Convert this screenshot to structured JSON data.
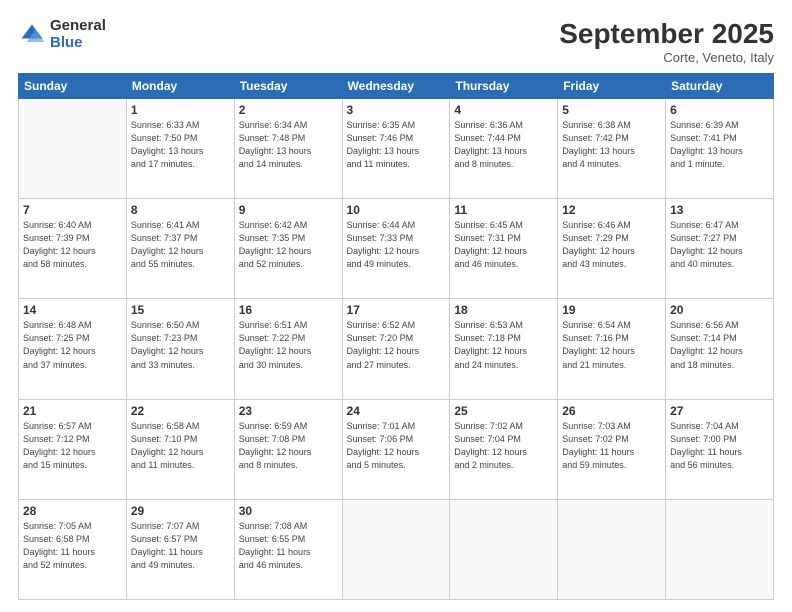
{
  "logo": {
    "general": "General",
    "blue": "Blue"
  },
  "header": {
    "title": "September 2025",
    "location": "Corte, Veneto, Italy"
  },
  "weekdays": [
    "Sunday",
    "Monday",
    "Tuesday",
    "Wednesday",
    "Thursday",
    "Friday",
    "Saturday"
  ],
  "weeks": [
    [
      {
        "day": "",
        "info": ""
      },
      {
        "day": "1",
        "info": "Sunrise: 6:33 AM\nSunset: 7:50 PM\nDaylight: 13 hours\nand 17 minutes."
      },
      {
        "day": "2",
        "info": "Sunrise: 6:34 AM\nSunset: 7:48 PM\nDaylight: 13 hours\nand 14 minutes."
      },
      {
        "day": "3",
        "info": "Sunrise: 6:35 AM\nSunset: 7:46 PM\nDaylight: 13 hours\nand 11 minutes."
      },
      {
        "day": "4",
        "info": "Sunrise: 6:36 AM\nSunset: 7:44 PM\nDaylight: 13 hours\nand 8 minutes."
      },
      {
        "day": "5",
        "info": "Sunrise: 6:38 AM\nSunset: 7:42 PM\nDaylight: 13 hours\nand 4 minutes."
      },
      {
        "day": "6",
        "info": "Sunrise: 6:39 AM\nSunset: 7:41 PM\nDaylight: 13 hours\nand 1 minute."
      }
    ],
    [
      {
        "day": "7",
        "info": "Sunrise: 6:40 AM\nSunset: 7:39 PM\nDaylight: 12 hours\nand 58 minutes."
      },
      {
        "day": "8",
        "info": "Sunrise: 6:41 AM\nSunset: 7:37 PM\nDaylight: 12 hours\nand 55 minutes."
      },
      {
        "day": "9",
        "info": "Sunrise: 6:42 AM\nSunset: 7:35 PM\nDaylight: 12 hours\nand 52 minutes."
      },
      {
        "day": "10",
        "info": "Sunrise: 6:44 AM\nSunset: 7:33 PM\nDaylight: 12 hours\nand 49 minutes."
      },
      {
        "day": "11",
        "info": "Sunrise: 6:45 AM\nSunset: 7:31 PM\nDaylight: 12 hours\nand 46 minutes."
      },
      {
        "day": "12",
        "info": "Sunrise: 6:46 AM\nSunset: 7:29 PM\nDaylight: 12 hours\nand 43 minutes."
      },
      {
        "day": "13",
        "info": "Sunrise: 6:47 AM\nSunset: 7:27 PM\nDaylight: 12 hours\nand 40 minutes."
      }
    ],
    [
      {
        "day": "14",
        "info": "Sunrise: 6:48 AM\nSunset: 7:25 PM\nDaylight: 12 hours\nand 37 minutes."
      },
      {
        "day": "15",
        "info": "Sunrise: 6:50 AM\nSunset: 7:23 PM\nDaylight: 12 hours\nand 33 minutes."
      },
      {
        "day": "16",
        "info": "Sunrise: 6:51 AM\nSunset: 7:22 PM\nDaylight: 12 hours\nand 30 minutes."
      },
      {
        "day": "17",
        "info": "Sunrise: 6:52 AM\nSunset: 7:20 PM\nDaylight: 12 hours\nand 27 minutes."
      },
      {
        "day": "18",
        "info": "Sunrise: 6:53 AM\nSunset: 7:18 PM\nDaylight: 12 hours\nand 24 minutes."
      },
      {
        "day": "19",
        "info": "Sunrise: 6:54 AM\nSunset: 7:16 PM\nDaylight: 12 hours\nand 21 minutes."
      },
      {
        "day": "20",
        "info": "Sunrise: 6:56 AM\nSunset: 7:14 PM\nDaylight: 12 hours\nand 18 minutes."
      }
    ],
    [
      {
        "day": "21",
        "info": "Sunrise: 6:57 AM\nSunset: 7:12 PM\nDaylight: 12 hours\nand 15 minutes."
      },
      {
        "day": "22",
        "info": "Sunrise: 6:58 AM\nSunset: 7:10 PM\nDaylight: 12 hours\nand 11 minutes."
      },
      {
        "day": "23",
        "info": "Sunrise: 6:59 AM\nSunset: 7:08 PM\nDaylight: 12 hours\nand 8 minutes."
      },
      {
        "day": "24",
        "info": "Sunrise: 7:01 AM\nSunset: 7:06 PM\nDaylight: 12 hours\nand 5 minutes."
      },
      {
        "day": "25",
        "info": "Sunrise: 7:02 AM\nSunset: 7:04 PM\nDaylight: 12 hours\nand 2 minutes."
      },
      {
        "day": "26",
        "info": "Sunrise: 7:03 AM\nSunset: 7:02 PM\nDaylight: 11 hours\nand 59 minutes."
      },
      {
        "day": "27",
        "info": "Sunrise: 7:04 AM\nSunset: 7:00 PM\nDaylight: 11 hours\nand 56 minutes."
      }
    ],
    [
      {
        "day": "28",
        "info": "Sunrise: 7:05 AM\nSunset: 6:58 PM\nDaylight: 11 hours\nand 52 minutes."
      },
      {
        "day": "29",
        "info": "Sunrise: 7:07 AM\nSunset: 6:57 PM\nDaylight: 11 hours\nand 49 minutes."
      },
      {
        "day": "30",
        "info": "Sunrise: 7:08 AM\nSunset: 6:55 PM\nDaylight: 11 hours\nand 46 minutes."
      },
      {
        "day": "",
        "info": ""
      },
      {
        "day": "",
        "info": ""
      },
      {
        "day": "",
        "info": ""
      },
      {
        "day": "",
        "info": ""
      }
    ]
  ]
}
